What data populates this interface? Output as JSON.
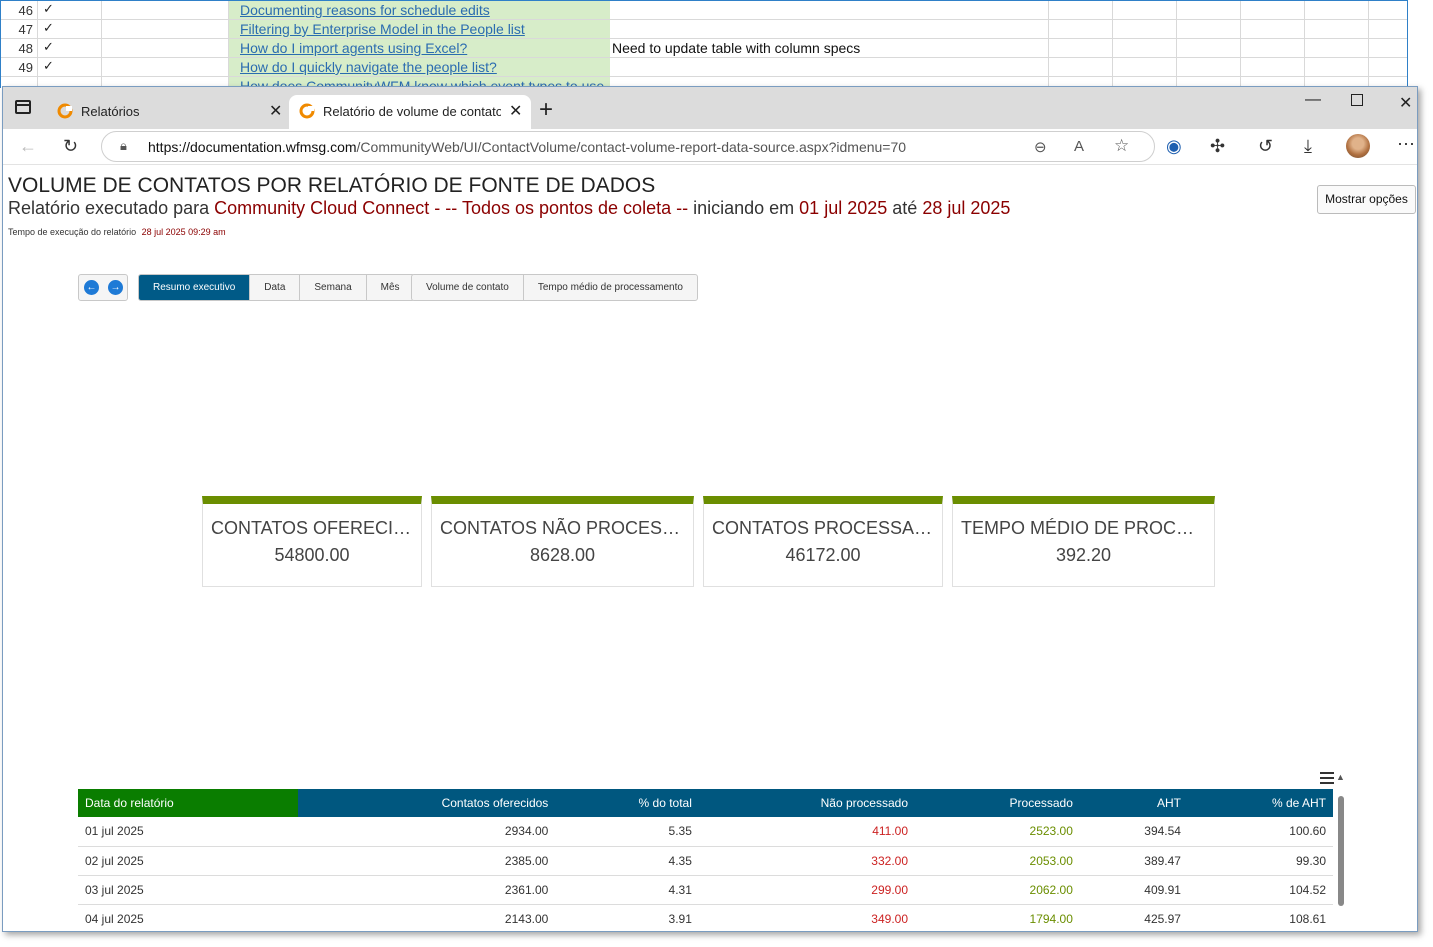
{
  "spreadsheet": {
    "rows": [
      {
        "num": "46",
        "check": "✓",
        "link": "Documenting reasons for schedule edits",
        "note": ""
      },
      {
        "num": "47",
        "check": "✓",
        "link": "Filtering by Enterprise Model in the People list",
        "note": ""
      },
      {
        "num": "48",
        "check": "✓",
        "link": "How do I import agents using Excel?",
        "note": "Need to update table with column specs"
      },
      {
        "num": "49",
        "check": "✓",
        "link": "How do I quickly navigate the people list?",
        "note": ""
      },
      {
        "num": "",
        "check": "",
        "link": "How does CommunityWFM know which event types to use",
        "note": ""
      }
    ]
  },
  "browser": {
    "tabs": [
      {
        "title": "Relatórios"
      },
      {
        "title": "Relatório de volume de contatos por fonte de dados"
      }
    ],
    "url_host": "https://documentation.wfmsg.com",
    "url_path": "/CommunityWeb/UI/ContactVolume/contact-volume-report-data-source.aspx?idmenu=70",
    "icons": [
      "tab-actions-icon",
      "back-icon",
      "refresh-icon",
      "lock-icon",
      "zoom-out-icon",
      "read-aloud-icon",
      "favorite-icon",
      "password-manager-icon",
      "extensions-icon",
      "history-icon",
      "downloads-icon",
      "profile-avatar",
      "more-icon"
    ]
  },
  "report": {
    "title": "VOLUME DE CONTATOS POR RELATÓRIO DE FONTE DE DADOS",
    "sub_prefix": "Relatório executado para",
    "sub_org": "Community Cloud Connect",
    "sub_points": "- -- Todos os pontos de coleta --",
    "sub_start_label": "iniciando em",
    "sub_start": "01 jul 2025",
    "sub_to": "até",
    "sub_end": "28 jul 2025",
    "time_label": "Tempo de execução do relatório",
    "time_value": "28 jul 2025 09:29 am",
    "options_button": "Mostrar opções"
  },
  "toolbar": {
    "view_tabs": [
      "Resumo executivo",
      "Data",
      "Semana",
      "Mês"
    ],
    "metric_tabs": [
      "Volume de contato",
      "Tempo médio de processamento"
    ],
    "active_view": "Resumo executivo"
  },
  "cards": [
    {
      "label": "CONTATOS OFERECIDOS",
      "value": "54800.00"
    },
    {
      "label": "CONTATOS NÃO PROCESSADOS",
      "value": "8628.00"
    },
    {
      "label": "CONTATOS PROCESSADOS",
      "value": "46172.00"
    },
    {
      "label": "TEMPO MÉDIO DE PROCESSAMENTO",
      "value": "392.20"
    }
  ],
  "table": {
    "headers": [
      "Data do relatório",
      "Contatos oferecidos",
      "% do total",
      "Não processado",
      "Processado",
      "AHT",
      "% de AHT"
    ],
    "rows": [
      [
        "01 jul 2025",
        "2934.00",
        "5.35",
        "411.00",
        "2523.00",
        "394.54",
        "100.60"
      ],
      [
        "02 jul 2025",
        "2385.00",
        "4.35",
        "332.00",
        "2053.00",
        "389.47",
        "99.30"
      ],
      [
        "03 jul 2025",
        "2361.00",
        "4.31",
        "299.00",
        "2062.00",
        "409.91",
        "104.52"
      ],
      [
        "04 jul 2025",
        "2143.00",
        "3.91",
        "349.00",
        "1794.00",
        "425.97",
        "108.61"
      ]
    ]
  },
  "colors": {
    "accent_dark_red": "#8b0000",
    "header_blue": "#00577f",
    "header_green": "#0a7d00",
    "card_bar": "#6b8e00",
    "negative": "#cc2222",
    "positive": "#6b8e00"
  }
}
